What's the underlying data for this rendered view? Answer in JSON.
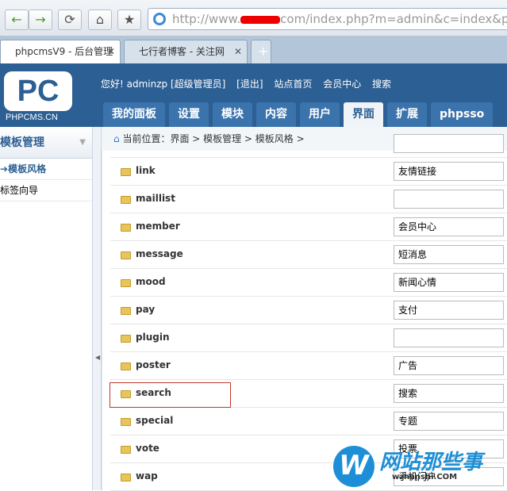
{
  "browser": {
    "url_prefix": "http://www.",
    "url_suffix": "com/index.php?m=admin&c=index&pc_hash",
    "tabs": [
      {
        "label": "phpcmsV9 - 后台管理"
      },
      {
        "label": "七行者博客 - 关注网"
      }
    ],
    "new_tab": "+",
    "close": "✕"
  },
  "header": {
    "logo": "PC",
    "logo_text": "PHPCMS.CN",
    "links": [
      "您好! adminzp [超级管理员]",
      "[退出]",
      "站点首页",
      "会员中心",
      "搜索"
    ],
    "nav": [
      "我的面板",
      "设置",
      "模块",
      "内容",
      "用户",
      "界面",
      "扩展",
      "phpsso"
    ],
    "active_nav": "界面"
  },
  "sidebar": {
    "title": "模板管理",
    "items": [
      "模板风格",
      "标签向导"
    ]
  },
  "breadcrumb": "当前位置：界面 > 模板管理 > 模板风格 >",
  "rows": [
    {
      "name": "link",
      "value": "友情链接"
    },
    {
      "name": "maillist",
      "value": ""
    },
    {
      "name": "member",
      "value": "会员中心"
    },
    {
      "name": "message",
      "value": "短消息"
    },
    {
      "name": "mood",
      "value": "新闻心情"
    },
    {
      "name": "pay",
      "value": "支付"
    },
    {
      "name": "plugin",
      "value": ""
    },
    {
      "name": "poster",
      "value": "广告"
    },
    {
      "name": "search",
      "value": "搜索"
    },
    {
      "name": "special",
      "value": "专题"
    },
    {
      "name": "vote",
      "value": "投票"
    },
    {
      "name": "wap",
      "value": "手机门户"
    }
  ],
  "highlighted_row": "search",
  "watermark": {
    "logo": "W",
    "text": "网站那些事",
    "site": "wzhanshi.COM"
  }
}
